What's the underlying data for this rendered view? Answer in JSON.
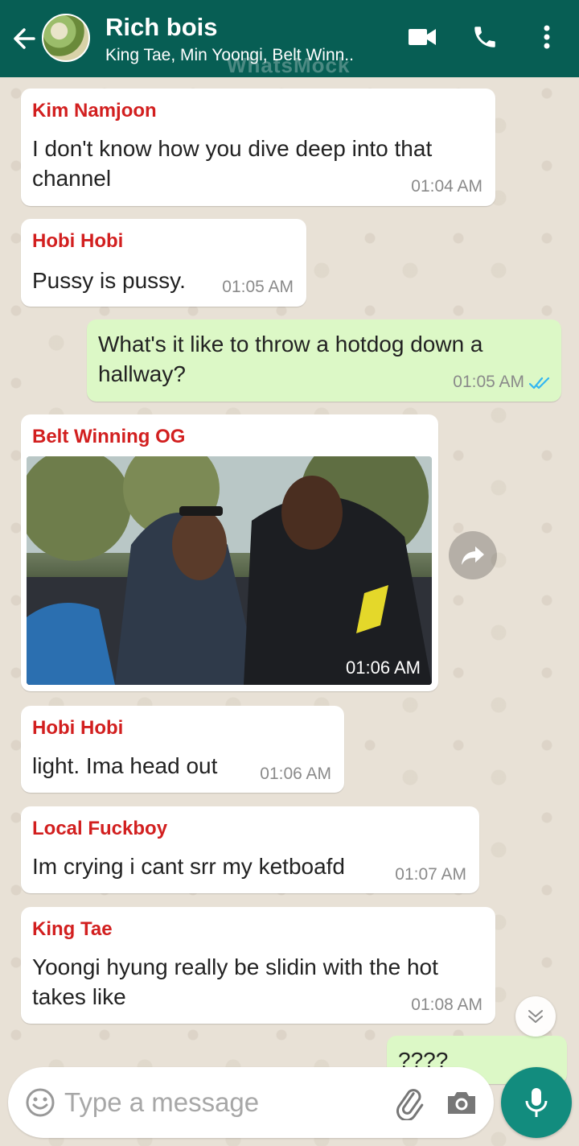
{
  "header": {
    "title": "Rich bois",
    "subtitle": "King Tae, Min Yoongi, Belt Winn..",
    "watermark": "WhatsMock"
  },
  "messages": [
    {
      "sender": "Kim Namjoon",
      "lines": [
        "I don't know how you dive deep into that",
        "channel"
      ],
      "time": "01:04 AM",
      "direction": "in"
    },
    {
      "sender": "Hobi Hobi",
      "lines": [
        "Pussy is pussy."
      ],
      "time": "01:05 AM",
      "direction": "in"
    },
    {
      "lines": [
        "What's it like to throw a hotdog down a",
        "hallway?"
      ],
      "time": "01:05 AM",
      "direction": "out",
      "status": "read"
    },
    {
      "sender": "Belt Winning OG",
      "type": "video",
      "time": "01:06 AM",
      "direction": "in"
    },
    {
      "sender": "Hobi Hobi",
      "lines": [
        "light. Ima head out"
      ],
      "time": "01:06 AM",
      "direction": "in"
    },
    {
      "sender": "Local Fuckboy",
      "lines": [
        "Im crying i cant srr my ketboafd"
      ],
      "time": "01:07 AM",
      "direction": "in"
    },
    {
      "sender": "King Tae",
      "lines": [
        "Yoongi hyung really be slidin with the hot",
        "takes like"
      ],
      "time": "01:08 AM",
      "direction": "in"
    },
    {
      "lines": [
        "????"
      ],
      "direction": "out",
      "partial": true
    }
  ],
  "input": {
    "placeholder": "Type a message"
  },
  "icons": {
    "back": "arrow-left-icon",
    "video": "video-camera-icon",
    "call": "phone-icon",
    "menu": "more-vert-icon",
    "forward": "forward-icon",
    "scroll": "chevron-double-down-icon",
    "emoji": "emoji-icon",
    "attach": "paperclip-icon",
    "camera": "camera-icon",
    "mic": "mic-icon"
  },
  "colors": {
    "header": "#075e54",
    "incoming": "#ffffff",
    "outgoing": "#dcf8c6",
    "sender_name": "#d21f1f",
    "read_ticks": "#34b7f1",
    "mic": "#128c7e"
  }
}
